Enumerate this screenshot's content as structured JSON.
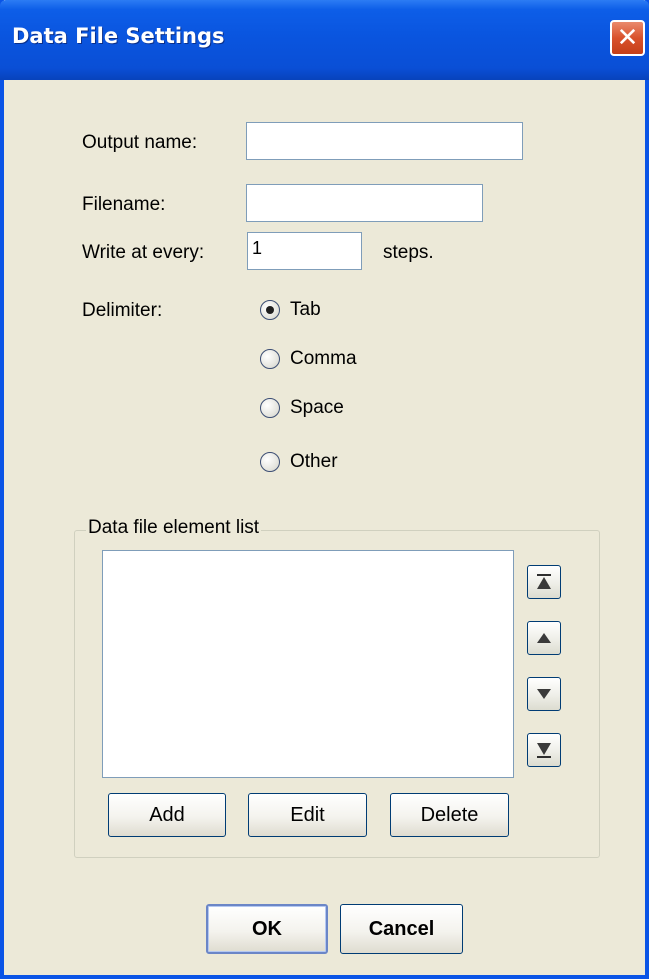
{
  "window": {
    "title": "Data File Settings",
    "close_icon": "close-icon"
  },
  "form": {
    "output_name_label": "Output name:",
    "output_name_value": "",
    "filename_label": "Filename:",
    "filename_value": "",
    "write_every_label": "Write at every:",
    "write_every_value": "1",
    "steps_label": "steps.",
    "delimiter_label": "Delimiter:",
    "delimiter_options": [
      {
        "label": "Tab",
        "selected": true
      },
      {
        "label": "Comma",
        "selected": false
      },
      {
        "label": "Space",
        "selected": false
      },
      {
        "label": "Other",
        "selected": false
      }
    ]
  },
  "element_list": {
    "title": "Data file element list",
    "items": [],
    "move_buttons": [
      "move-to-top-icon",
      "move-up-icon",
      "move-down-icon",
      "move-to-bottom-icon"
    ],
    "add_label": "Add",
    "edit_label": "Edit",
    "delete_label": "Delete"
  },
  "footer": {
    "ok_label": "OK",
    "cancel_label": "Cancel"
  },
  "colors": {
    "titlebar": "#0a55df",
    "dialog_bg": "#ece9d8",
    "close": "#d9522c"
  }
}
